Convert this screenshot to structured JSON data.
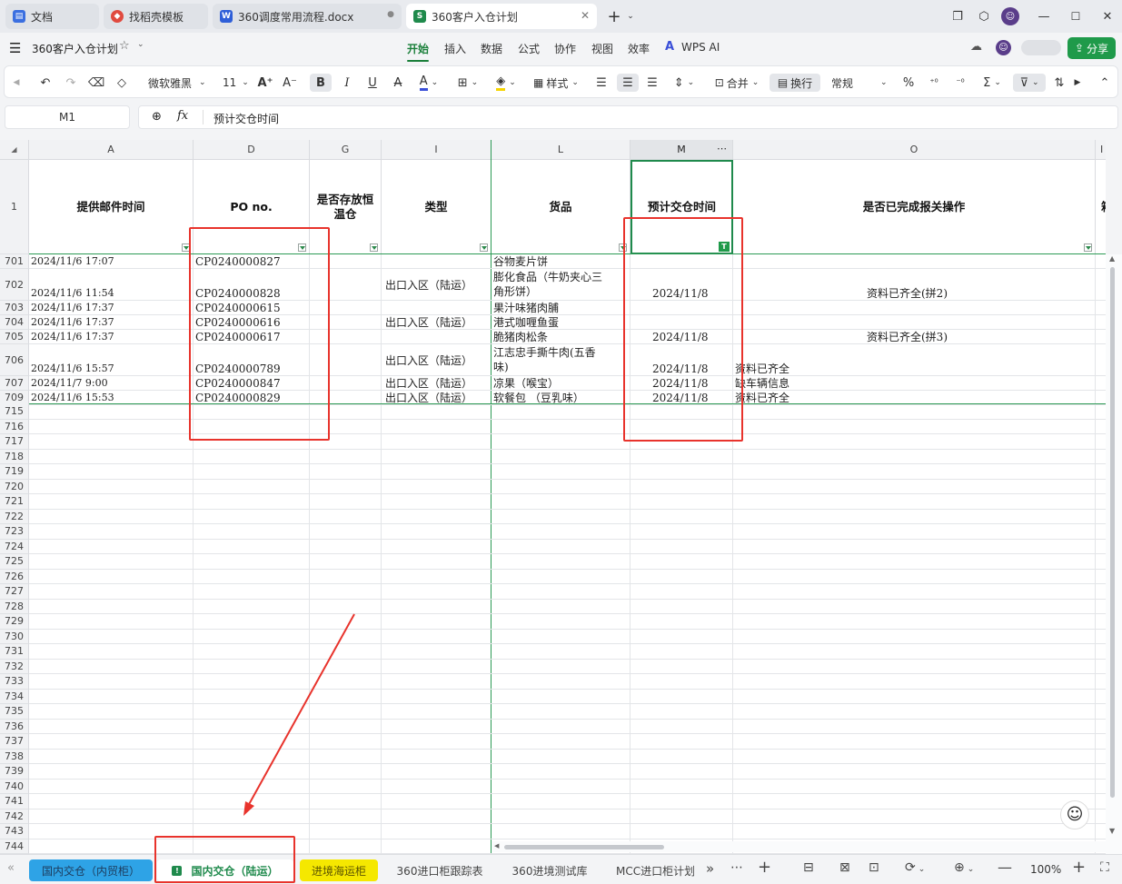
{
  "tabs": [
    {
      "label": "文档",
      "icon_color": "#3b6fe0",
      "icon": "doc-icon"
    },
    {
      "label": "找稻壳模板",
      "icon_color": "#e04a3f",
      "icon": "docer-icon"
    },
    {
      "label": "360调度常用流程.docx",
      "icon_color": "#2f5fd8",
      "icon": "word-icon",
      "icon_text": "W"
    },
    {
      "label": "360客户入仓计划",
      "icon_color": "#1f8a4c",
      "icon": "sheet-icon",
      "icon_text": "S"
    }
  ],
  "file": {
    "title": "360客户入仓计划"
  },
  "menu": [
    "开始",
    "插入",
    "数据",
    "公式",
    "协作",
    "视图",
    "效率",
    "WPS AI"
  ],
  "share_label": "分享",
  "toolbar": {
    "font_name": "微软雅黑",
    "font_size": "11",
    "style_label": "样式",
    "merge_label": "合并",
    "wrap_label": "换行",
    "number_format": "常规"
  },
  "formula": {
    "cell_ref": "M1",
    "fx": "fx",
    "content": "预计交仓时间"
  },
  "columns": [
    {
      "letter": "A",
      "header": "提供邮件时间"
    },
    {
      "letter": "D",
      "header": "PO no."
    },
    {
      "letter": "G",
      "header": "是否存放恒温仓"
    },
    {
      "letter": "I",
      "header": "类型"
    },
    {
      "letter": "L",
      "header": "货品"
    },
    {
      "letter": "M",
      "header": "预计交仓时间"
    },
    {
      "letter": "O",
      "header": "是否已完成报关操作"
    },
    {
      "letter": "I",
      "header": "箱"
    }
  ],
  "header_row_number": "1",
  "rows": [
    {
      "num": "701",
      "a": "2024/11/6 17:07",
      "d": "CP0240000827",
      "i": "",
      "l": "谷物麦片饼",
      "m": "",
      "o": ""
    },
    {
      "num": "702",
      "a": "2024/11/6 11:54",
      "d": "CP0240000828",
      "i": "出口入区（陆运）",
      "l": "膨化食品（牛奶夹心三",
      "l2": "角形饼）",
      "m": "2024/11/8",
      "o": "资料已齐全(拼2)"
    },
    {
      "num": "703",
      "a": "2024/11/6 17:37",
      "d": "CP0240000615",
      "i": "",
      "l": "果汁味猪肉脯",
      "m": "",
      "o": ""
    },
    {
      "num": "704",
      "a": "2024/11/6 17:37",
      "d": "CP0240000616",
      "i": "出口入区（陆运）",
      "l": "港式咖喱鱼蛋",
      "m": "",
      "o": ""
    },
    {
      "num": "705",
      "a": "2024/11/6 17:37",
      "d": "CP0240000617",
      "i": "",
      "l": "脆猪肉松条",
      "m": "2024/11/8",
      "o": "资料已齐全(拼3)"
    },
    {
      "num": "706",
      "a": "2024/11/6 15:57",
      "d": "CP0240000789",
      "i": "出口入区（陆运）",
      "l": "江志忠手撕牛肉(五香",
      "l2": "味)",
      "m": "2024/11/8",
      "o": "资料已齐全"
    },
    {
      "num": "707",
      "a": "2024/11/7 9:00",
      "d": "CP0240000847",
      "i": "出口入区（陆运）",
      "l": "凉果（喉宝）",
      "m": "2024/11/8",
      "o": "缺车辆信息"
    },
    {
      "num": "709",
      "a": "2024/11/6 15:53",
      "d": "CP0240000829",
      "i": "出口入区（陆运）",
      "l": "软餐包 （豆乳味）",
      "m": "2024/11/8",
      "o": "资料已齐全"
    }
  ],
  "empty_rows": [
    "715",
    "716",
    "717",
    "718",
    "719",
    "720",
    "721",
    "722",
    "723",
    "724",
    "725",
    "726",
    "727",
    "728",
    "729",
    "730",
    "731",
    "732",
    "733",
    "734",
    "735",
    "736",
    "737",
    "738",
    "739",
    "740",
    "741",
    "742",
    "743",
    "744"
  ],
  "sheets": [
    {
      "label": "国内交仓（内贸柜）",
      "style": "blue"
    },
    {
      "label": "国内交仓（陆运）",
      "style": "active"
    },
    {
      "label": "进境海运柜",
      "style": "yellow"
    },
    {
      "label": "360进口柜跟踪表",
      "style": "plain"
    },
    {
      "label": "360进境测试库",
      "style": "plain"
    },
    {
      "label": "MCC进口柜计划",
      "style": "plain"
    }
  ],
  "zoom": "100%"
}
